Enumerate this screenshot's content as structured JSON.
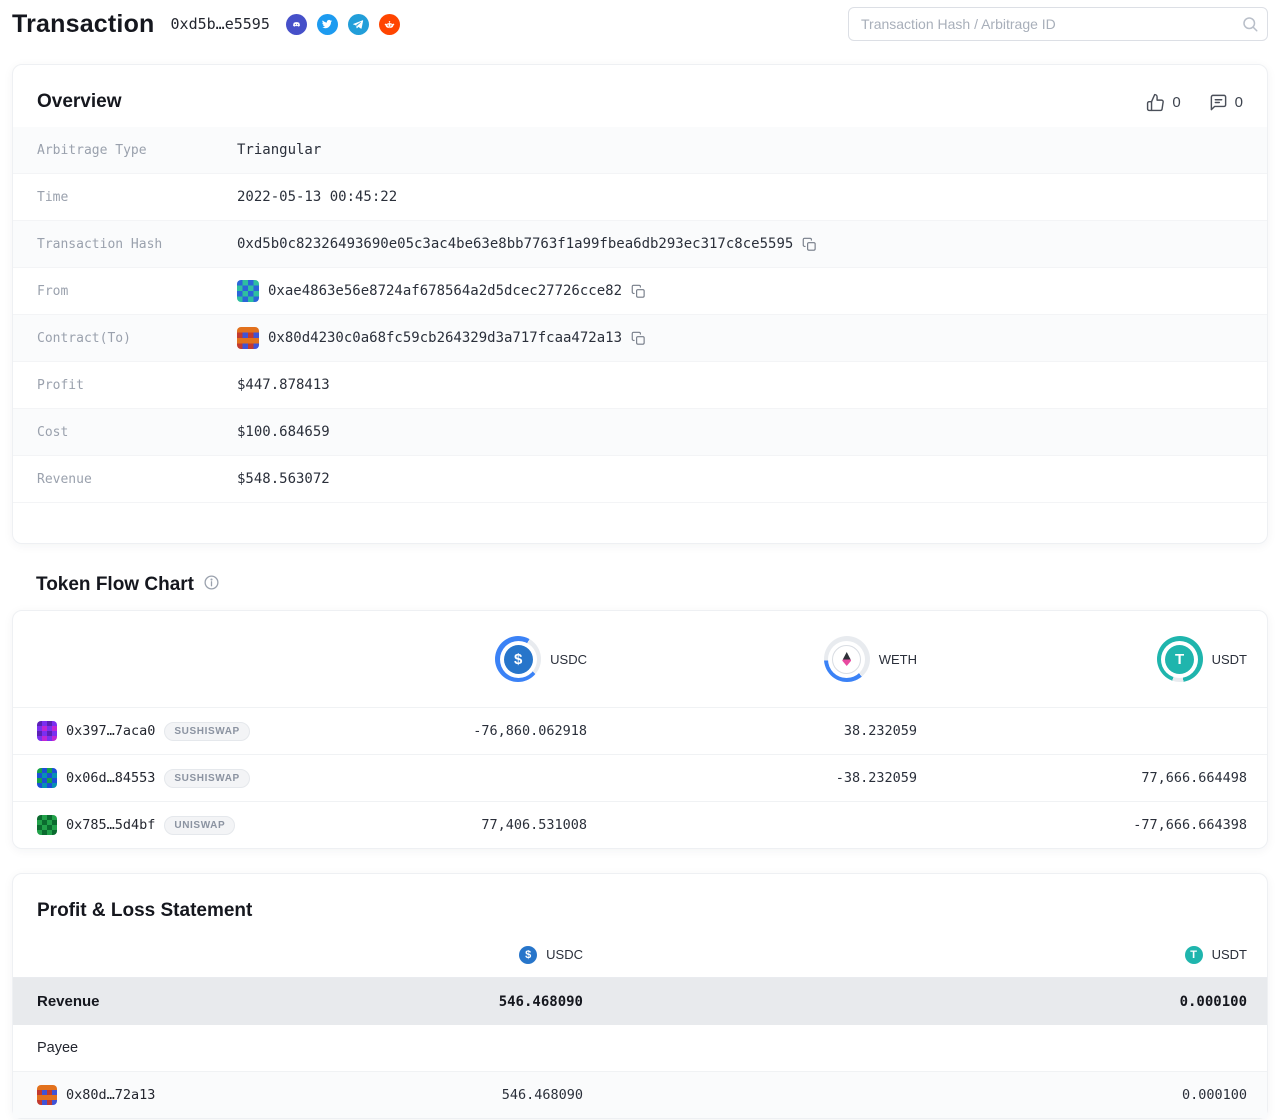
{
  "colors": {
    "accent_blue": "#3b82f6",
    "usdc": "#2775ca",
    "usdt": "#1fb5ad",
    "weth_pink": "#e84aa0",
    "discord": "#4650c9",
    "twitter": "#1d9bf0",
    "telegram": "#229ed9",
    "reddit": "#ff4500",
    "revenue_highlight": "#e8eaed"
  },
  "icons": {
    "search": "search-icon",
    "like": "thumbs-up-icon",
    "comment": "comment-icon",
    "copy": "copy-icon",
    "info": "info-icon",
    "socials": [
      "discord-icon",
      "twitter-icon",
      "telegram-icon",
      "reddit-icon"
    ]
  },
  "header": {
    "title": "Transaction",
    "tx_short": "0xd5b…e5595",
    "search_placeholder": "Transaction Hash / Arbitrage ID"
  },
  "overview": {
    "title": "Overview",
    "like_count": "0",
    "comment_count": "0",
    "rows": [
      {
        "label": "Arbitrage Type",
        "value": "Triangular"
      },
      {
        "label": "Time",
        "value": "2022-05-13 00:45:22"
      },
      {
        "label": "Transaction Hash",
        "value": "0xd5b0c82326493690e05c3ac4be63e8bb7763f1a99fbea6db293ec317c8ce5595"
      },
      {
        "label": "From",
        "value": "0xae4863e56e8724af678564a2d5dcec27726cce82"
      },
      {
        "label": "Contract(To)",
        "value": "0x80d4230c0a68fc59cb264329d3a717fcaa472a13"
      },
      {
        "label": "Profit",
        "value": "$447.878413"
      },
      {
        "label": "Cost",
        "value": "$100.684659"
      },
      {
        "label": "Revenue",
        "value": "$548.563072"
      }
    ]
  },
  "token_flow": {
    "title": "Token Flow Chart",
    "tokens": [
      {
        "symbol": "USDC"
      },
      {
        "symbol": "WETH"
      },
      {
        "symbol": "USDT"
      }
    ],
    "rows": [
      {
        "address": "0x397…7aca0",
        "venue": "SUSHISWAP",
        "usdc": "-76,860.062918",
        "weth": "38.232059",
        "usdt": ""
      },
      {
        "address": "0x06d…84553",
        "venue": "SUSHISWAP",
        "usdc": "",
        "weth": "-38.232059",
        "usdt": "77,666.664498"
      },
      {
        "address": "0x785…5d4bf",
        "venue": "UNISWAP",
        "usdc": "77,406.531008",
        "weth": "",
        "usdt": "-77,666.664398"
      }
    ]
  },
  "pnl": {
    "title": "Profit & Loss Statement",
    "columns": [
      "USDC",
      "USDT"
    ],
    "revenue": {
      "label": "Revenue",
      "usdc": "546.468090",
      "usdt": "0.000100"
    },
    "payee_label": "Payee",
    "payees": [
      {
        "address": "0x80d…72a13",
        "usdc": "546.468090",
        "usdt": "0.000100"
      }
    ]
  }
}
